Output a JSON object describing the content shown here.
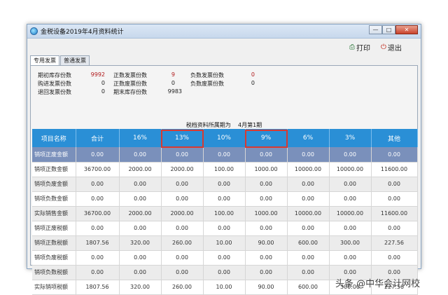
{
  "window": {
    "title": "金税设备2019年4月资料统计",
    "controls": {
      "minimize": "—",
      "maximize": "□",
      "close": "✕"
    }
  },
  "toolbar": {
    "print_label": "打印",
    "exit_label": "退出",
    "print_icon": "printer-icon",
    "exit_icon": "power-icon"
  },
  "tabs": [
    {
      "label": "专用发票",
      "active": true
    },
    {
      "label": "普通发票",
      "active": false
    }
  ],
  "stats": [
    {
      "label": "期初库存份数",
      "value": "9992"
    },
    {
      "label": "正数发票份数",
      "value": "9"
    },
    {
      "label": "负数发票份数",
      "value": "0"
    },
    {
      "label": "购进发票份数",
      "value": "0"
    },
    {
      "label": "正数废票份数",
      "value": "0"
    },
    {
      "label": "负数废票份数",
      "value": "0"
    },
    {
      "label": "退回发票份数",
      "value": "0"
    },
    {
      "label": "期末库存份数",
      "value": "9983"
    }
  ],
  "period": {
    "label": "税档资料所属期为",
    "value": "4月第1期"
  },
  "table": {
    "headers": [
      "项目名称",
      "合计",
      "16%",
      "13%",
      "10%",
      "9%",
      "6%",
      "3%",
      "其他"
    ],
    "rows": [
      [
        "销项正废金额",
        "0.00",
        "0.00",
        "0.00",
        "0.00",
        "0.00",
        "0.00",
        "0.00",
        "0.00"
      ],
      [
        "销项正数金额",
        "36700.00",
        "2000.00",
        "2000.00",
        "100.00",
        "1000.00",
        "10000.00",
        "10000.00",
        "11600.00"
      ],
      [
        "销项负废金额",
        "0.00",
        "0.00",
        "0.00",
        "0.00",
        "0.00",
        "0.00",
        "0.00",
        "0.00"
      ],
      [
        "销项负数金额",
        "0.00",
        "0.00",
        "0.00",
        "0.00",
        "0.00",
        "0.00",
        "0.00",
        "0.00"
      ],
      [
        "实际销售金额",
        "36700.00",
        "2000.00",
        "2000.00",
        "100.00",
        "1000.00",
        "10000.00",
        "10000.00",
        "11600.00"
      ],
      [
        "销项正废税额",
        "0.00",
        "0.00",
        "0.00",
        "0.00",
        "0.00",
        "0.00",
        "0.00",
        "0.00"
      ],
      [
        "销项正数税额",
        "1807.56",
        "320.00",
        "260.00",
        "10.00",
        "90.00",
        "600.00",
        "300.00",
        "227.56"
      ],
      [
        "销项负废税额",
        "0.00",
        "0.00",
        "0.00",
        "0.00",
        "0.00",
        "0.00",
        "0.00",
        "0.00"
      ],
      [
        "销项负数税额",
        "0.00",
        "0.00",
        "0.00",
        "0.00",
        "0.00",
        "0.00",
        "0.00",
        "0.00"
      ],
      [
        "实际销项税额",
        "1807.56",
        "320.00",
        "260.00",
        "10.00",
        "90.00",
        "600.00",
        "300.00",
        "227.56"
      ]
    ],
    "selected_row": 0,
    "highlighted_headers": [
      "13%",
      "9%"
    ]
  },
  "colors": {
    "header_bg": "#2a8fd6",
    "selected_row": "#7a90bb",
    "highlight": "#d83a32"
  },
  "watermark": "头条 @中华会计网校"
}
